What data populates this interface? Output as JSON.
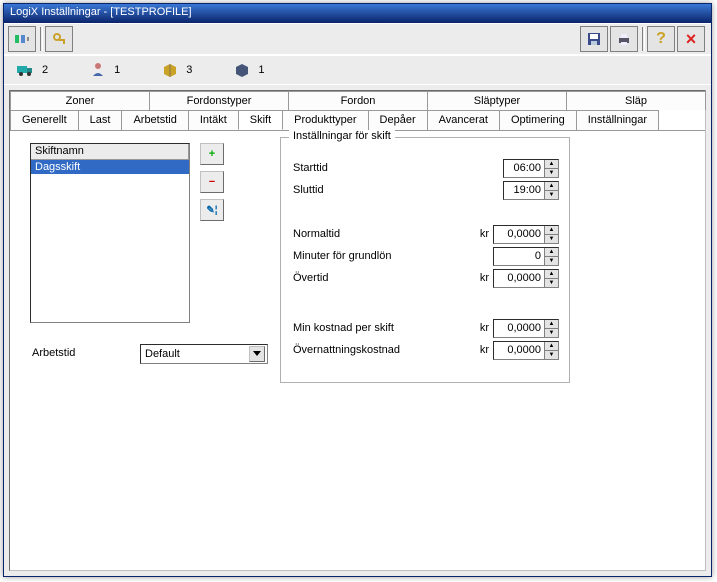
{
  "window": {
    "title": "LogiX Inställningar - [TESTPROFILE]"
  },
  "toolbar": {
    "save": "Save",
    "print": "Print",
    "help": "?",
    "close": "×"
  },
  "status": {
    "s1": "2",
    "s2": "1",
    "s3": "3",
    "s4": "1"
  },
  "tabs_top": [
    "Zoner",
    "Fordonstyper",
    "Fordon",
    "Släptyper",
    "Släp"
  ],
  "tabs_bottom": [
    "Generellt",
    "Last",
    "Arbetstid",
    "Intäkt",
    "Skift",
    "Produkttyper",
    "Depåer",
    "Avancerat",
    "Optimering",
    "Inställningar"
  ],
  "active_tab": "Skift",
  "shift_list": {
    "header": "Skiftnamn",
    "items": [
      "Dagsskift"
    ],
    "selected": 0
  },
  "arbetstid": {
    "label": "Arbetstid",
    "value": "Default"
  },
  "fieldset": {
    "legend": "Inställningar för skift",
    "starttid": {
      "label": "Starttid",
      "value": "06:00"
    },
    "sluttid": {
      "label": "Sluttid",
      "value": "19:00"
    },
    "normaltid": {
      "label": "Normaltid",
      "unit": "kr",
      "value": "0,0000"
    },
    "grundlon": {
      "label": "Minuter för grundlön",
      "value": "0"
    },
    "overtid": {
      "label": "Övertid",
      "unit": "kr",
      "value": "0,0000"
    },
    "minkostnad": {
      "label": "Min kostnad per skift",
      "unit": "kr",
      "value": "0,0000"
    },
    "overnattning": {
      "label": "Övernattningskostnad",
      "unit": "kr",
      "value": "0,0000"
    }
  }
}
